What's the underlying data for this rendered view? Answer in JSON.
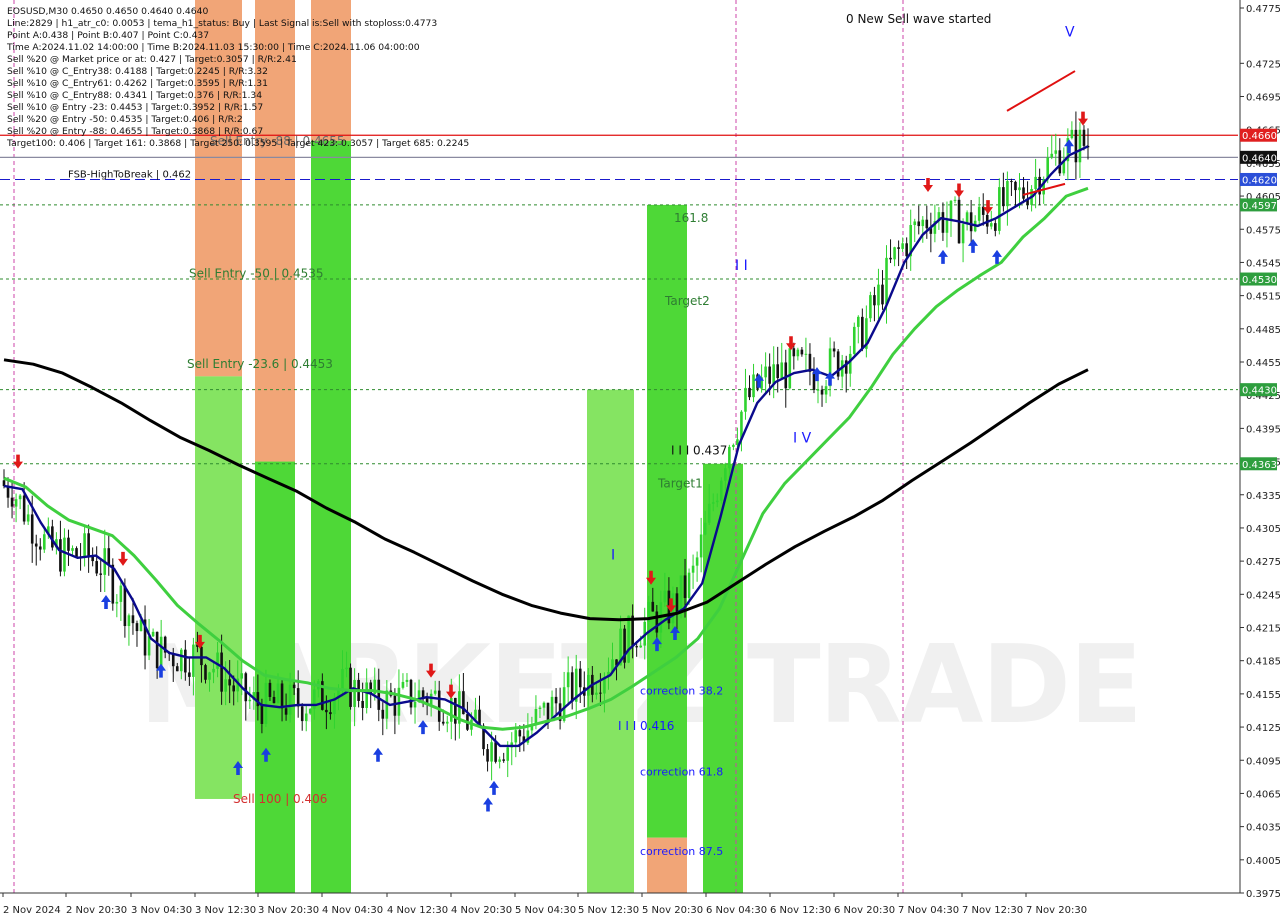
{
  "info_lines": [
    "EOSUSD,M30  0.4650 0.4650 0.4640 0.4640",
    "Line:2829  | h1_atr_c0: 0.0053  | tema_h1_status: Buy  | Last Signal is:Sell with stoploss:0.4773",
    "Point A:0.438  | Point B:0.407  | Point C:0.437",
    "Time A:2024.11.02 14:00:00  | Time B:2024.11.03 15:30:00  | Time C:2024.11.06 04:00:00",
    "Sell %20 @ Market price or at: 0.427  | Target:0.3057  | R/R:2.41",
    "Sell %10 @ C_Entry38: 0.4188  | Target:0.2245  | R/R:3.32",
    "Sell %10 @ C_Entry61: 0.4262  | Target:0.3595  | R/R:1.31",
    "Sell %10 @ C_Entry88: 0.4341  | Target:0.376  | R/R:1.34",
    "Sell %10 @ Entry -23: 0.4453  | Target:0.3952  | R/R:1.57",
    "Sell %20 @ Entry -50: 0.4535  | Target:0.406  | R/R:2",
    "Sell %20 @ Entry -88: 0.4655  | Target:0.3868  | R/R:0.67",
    "Target100: 0.406  | Target 161: 0.3868  | Target 250: 0.3595  | Target 423: 0.3057  | Target 685: 0.2245"
  ],
  "fsb_label": "FSB-HighToBreak  |  0.462",
  "wave_status": "0 New Sell wave started",
  "watermark": "MARKETZITRADE",
  "zone_labels": [
    {
      "text": "Sell Entry -88 | 0.4655",
      "price": 0.4655,
      "color": "#6a6a6a"
    },
    {
      "text": "Sell Entry -50 | 0.4535",
      "price": 0.4535,
      "color": "#2e7d32"
    },
    {
      "text": "Sell Entry -23.6 | 0.4453",
      "price": 0.4453,
      "color": "#2e7d32"
    },
    {
      "text": "Sell 100 | 0.406",
      "price": 0.406,
      "color": "#d32f2f"
    },
    {
      "text": "161.8",
      "price": 0.4585,
      "color": "#2e7d32"
    },
    {
      "text": "Target2",
      "price": 0.451,
      "color": "#2e7d32"
    },
    {
      "text": "Target1",
      "price": 0.4345,
      "color": "#2e7d32"
    },
    {
      "text": "I I I 0.437",
      "price": 0.4375,
      "color": "#111111"
    },
    {
      "text": "correction 38.2",
      "price": 0.4158,
      "color": "#1a1aff"
    },
    {
      "text": "I I I 0.416",
      "price": 0.4126,
      "color": "#1a1aff"
    },
    {
      "text": "correction 61.8",
      "price": 0.4085,
      "color": "#1a1aff"
    },
    {
      "text": "correction 87.5",
      "price": 0.4013,
      "color": "#1a1aff"
    }
  ],
  "wave_labels": [
    {
      "text": "I",
      "price": 0.428,
      "color": "#1a1aff"
    },
    {
      "text": "I I",
      "price": 0.4542,
      "color": "#1a1aff"
    },
    {
      "text": "I V",
      "price": 0.4386,
      "color": "#1a1aff"
    },
    {
      "text": "V",
      "price": 0.4753,
      "color": "#1a1aff"
    }
  ],
  "colors": {
    "background": "#ffffff",
    "up_candle": "#2fd32f",
    "down_candle": "#111111",
    "zone_green": "#7ee35a",
    "zone_bright_green": "#44d62c",
    "zone_orange": "#f0a070",
    "ema_navy": "#0a0a8c",
    "ema_green": "#3fcf3f",
    "ma_black": "#000000",
    "resistance_red": "#e01010",
    "fsb_blue": "#1a1acc",
    "level_green": "#2e8b2e",
    "separator_magenta": "#cc44aa",
    "badge_green": "#2e9e3e",
    "badge_red": "#e02020",
    "badge_blue": "#2b4fd8",
    "badge_black": "#111111"
  },
  "chart_data": {
    "type": "candlestick",
    "symbol": "EOSUSD",
    "timeframe": "M30",
    "ohlc_last": {
      "open": 0.465,
      "high": 0.465,
      "low": 0.464,
      "close": 0.464
    },
    "ylim": [
      0.3975,
      0.4775
    ],
    "y_ticks": [
      "0.4775",
      "0.4725",
      "0.4695",
      "0.4665",
      "0.4635",
      "0.4605",
      "0.4575",
      "0.4545",
      "0.4515",
      "0.4485",
      "0.4455",
      "0.4425",
      "0.4395",
      "0.4365",
      "0.4335",
      "0.4305",
      "0.4275",
      "0.4245",
      "0.4215",
      "0.4185",
      "0.4155",
      "0.4125",
      "0.4095",
      "0.4065",
      "0.4035",
      "0.4005",
      "0.3975"
    ],
    "x_ticks": [
      "2 Nov 2024",
      "2 Nov 20:30",
      "3 Nov 04:30",
      "3 Nov 12:30",
      "3 Nov 20:30",
      "4 Nov 04:30",
      "4 Nov 12:30",
      "4 Nov 20:30",
      "5 Nov 04:30",
      "5 Nov 12:30",
      "5 Nov 20:30",
      "6 Nov 04:30",
      "6 Nov 12:30",
      "6 Nov 20:30",
      "7 Nov 04:30",
      "7 Nov 12:30",
      "7 Nov 20:30"
    ],
    "horizontal_levels": [
      {
        "price": 0.466,
        "label": "0.4660",
        "style": "solid",
        "color": "#e01010"
      },
      {
        "price": 0.464,
        "label": "0.4640",
        "style": "solid",
        "color": "#8a8aa0"
      },
      {
        "price": 0.462,
        "label": "0.4620",
        "style": "dashed",
        "color": "#1a1acc"
      },
      {
        "price": 0.4597,
        "label": "0.4597",
        "style": "dotted",
        "color": "#2e8b2e"
      },
      {
        "price": 0.453,
        "label": "0.4530",
        "style": "dotted",
        "color": "#2e8b2e"
      },
      {
        "price": 0.443,
        "label": "0.4430",
        "style": "dotted",
        "color": "#2e8b2e"
      },
      {
        "price": 0.4363,
        "label": "0.4363",
        "style": "dotted",
        "color": "#2e8b2e"
      }
    ],
    "price_badges": [
      {
        "label": "0.4660",
        "color": "#e02020"
      },
      {
        "label": "0.4640",
        "color": "#111111"
      },
      {
        "label": "0.4620",
        "color": "#2b4fd8"
      },
      {
        "label": "0.4597",
        "color": "#2e9e3e"
      },
      {
        "label": "0.4530",
        "color": "#2e9e3e"
      },
      {
        "label": "0.4430",
        "color": "#2e9e3e"
      },
      {
        "label": "0.4363",
        "color": "#2e9e3e"
      }
    ],
    "zones": [
      {
        "color": "orange",
        "from": 0.4442,
        "to": 0.4785
      },
      {
        "color": "green",
        "from": 0.406,
        "to": 0.4442
      },
      {
        "color": "orange",
        "from": 0.4365,
        "to": 0.4785
      },
      {
        "color": "bright_green",
        "from": 0.3975,
        "to": 0.4365
      },
      {
        "color": "orange",
        "from": 0.4655,
        "to": 0.4785
      },
      {
        "color": "bright_green",
        "from": 0.3975,
        "to": 0.4655
      },
      {
        "color": "green",
        "from": 0.3975,
        "to": 0.443
      },
      {
        "color": "bright_green",
        "from": 0.4025,
        "to": 0.4597
      },
      {
        "color": "orange",
        "from": 0.3975,
        "to": 0.4025
      },
      {
        "color": "bright_green",
        "from": 0.3975,
        "to": 0.4363
      }
    ],
    "moving_averages": [
      {
        "color": "navy",
        "values": [
          0.4343,
          0.434,
          0.431,
          0.4285,
          0.4278,
          0.428,
          0.4268,
          0.424,
          0.4205,
          0.4192,
          0.4188,
          0.4188,
          0.4178,
          0.416,
          0.4145,
          0.4143,
          0.4145,
          0.4145,
          0.415,
          0.416,
          0.4155,
          0.4145,
          0.4148,
          0.4152,
          0.415,
          0.4142,
          0.4125,
          0.4108,
          0.4108,
          0.412,
          0.4135,
          0.415,
          0.4163,
          0.4172,
          0.4195,
          0.421,
          0.4222,
          0.4232,
          0.4255,
          0.4315,
          0.438,
          0.4418,
          0.4437,
          0.4445,
          0.4448,
          0.4442,
          0.4455,
          0.4472,
          0.4505,
          0.4545,
          0.457,
          0.4585,
          0.4582,
          0.4578,
          0.4585,
          0.4595,
          0.4605,
          0.4625,
          0.4642,
          0.465
        ]
      },
      {
        "color": "green",
        "values": [
          0.435,
          0.4342,
          0.4325,
          0.4312,
          0.4305,
          0.4298,
          0.428,
          0.4258,
          0.4235,
          0.4218,
          0.4202,
          0.4185,
          0.4172,
          0.4168,
          0.4165,
          0.416,
          0.4158,
          0.4158,
          0.4155,
          0.415,
          0.4142,
          0.4132,
          0.4125,
          0.4123,
          0.4125,
          0.413,
          0.4135,
          0.4142,
          0.415,
          0.4162,
          0.4175,
          0.4188,
          0.4205,
          0.4232,
          0.4275,
          0.4318,
          0.4345,
          0.4365,
          0.4385,
          0.4405,
          0.4432,
          0.4462,
          0.4485,
          0.4505,
          0.452,
          0.4533,
          0.4545,
          0.4568,
          0.4585,
          0.4605,
          0.4612
        ]
      },
      {
        "color": "black",
        "values": [
          0.4457,
          0.4453,
          0.4445,
          0.4432,
          0.4418,
          0.4402,
          0.4387,
          0.4375,
          0.4362,
          0.435,
          0.4338,
          0.4323,
          0.431,
          0.4295,
          0.4283,
          0.427,
          0.4257,
          0.4245,
          0.4235,
          0.4228,
          0.4223,
          0.4222,
          0.4223,
          0.4228,
          0.4238,
          0.4255,
          0.4272,
          0.4288,
          0.4302,
          0.4315,
          0.433,
          0.4348,
          0.4365,
          0.4382,
          0.44,
          0.4418,
          0.4435,
          0.4448
        ]
      }
    ]
  }
}
